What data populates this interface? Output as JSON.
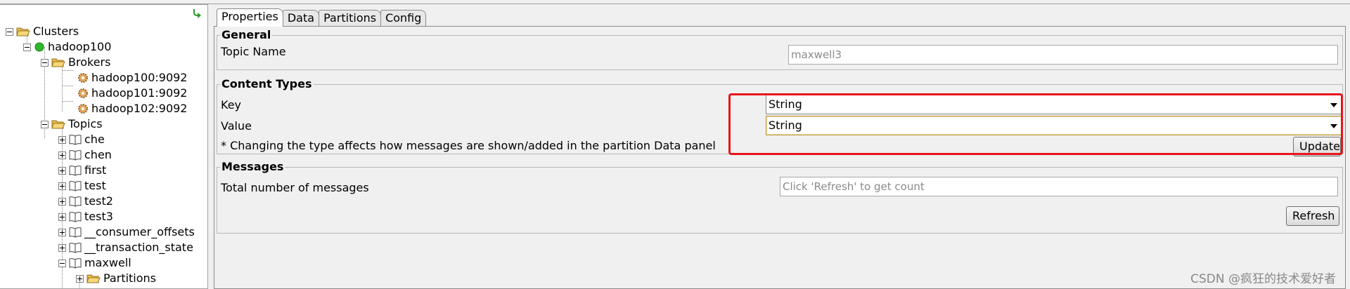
{
  "tree": {
    "root": "Clusters",
    "cluster": "hadoop100",
    "brokers_label": "Brokers",
    "brokers": [
      "hadoop100:9092",
      "hadoop101:9092",
      "hadoop102:9092"
    ],
    "topics_label": "Topics",
    "topics": [
      "che",
      "chen",
      "first",
      "test",
      "test2",
      "test3",
      "__consumer_offsets",
      "__transaction_state",
      "maxwell"
    ],
    "partitions_label": "Partitions"
  },
  "tabs": [
    "Properties",
    "Data",
    "Partitions",
    "Config"
  ],
  "general": {
    "title": "General",
    "topic_name_label": "Topic Name",
    "topic_name_value": "maxwell3"
  },
  "content_types": {
    "title": "Content Types",
    "key_label": "Key",
    "key_value": "String",
    "value_label": "Value",
    "value_value": "String",
    "note": "* Changing the type affects how messages are shown/added in the partition Data panel",
    "update_button": "Update"
  },
  "messages": {
    "title": "Messages",
    "total_label": "Total number of messages",
    "count_placeholder": "Click 'Refresh' to get count",
    "refresh_button": "Refresh"
  },
  "watermark": "CSDN @疯狂的技术爱好者",
  "colors": {
    "highlight": "#e8141b",
    "status_green": "#2db82d"
  }
}
